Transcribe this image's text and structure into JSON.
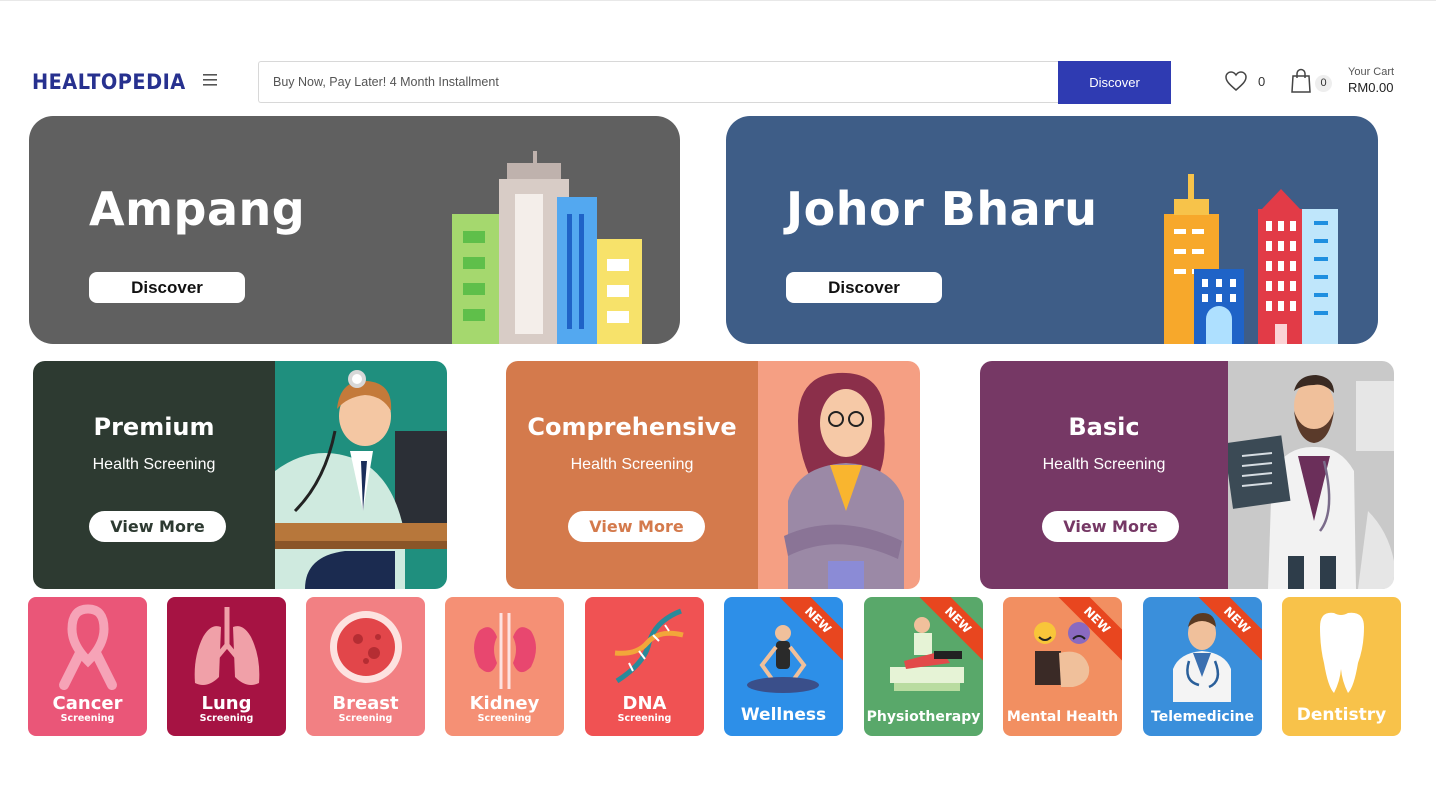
{
  "header": {
    "logo_text": "HEALTOPEDIA",
    "search_placeholder": "Buy Now, Pay Later! 4 Month Installment",
    "search_button": "Discover",
    "wishlist_count": "0",
    "cart_count": "0",
    "cart_label": "Your Cart",
    "cart_total": "RM0.00"
  },
  "cities": [
    {
      "name": "Ampang",
      "button": "Discover",
      "bg": "#606060"
    },
    {
      "name": "Johor Bharu",
      "button": "Discover",
      "bg": "#3e5d87"
    }
  ],
  "screenings": [
    {
      "title": "Premium",
      "subtitle": "Health Screening",
      "button": "View More",
      "bg": "#2d3a31",
      "art_bg": "#1f8f7e",
      "btn_color": "#2d3a31"
    },
    {
      "title": "Comprehensive",
      "subtitle": "Health Screening",
      "button": "View More",
      "bg": "#d47a4c",
      "art_bg": "#f59f83",
      "btn_color": "#d47a4c"
    },
    {
      "title": "Basic",
      "subtitle": "Health Screening",
      "button": "View More",
      "bg": "#763865",
      "art_bg": "#c9c9c9",
      "btn_color": "#763865"
    }
  ],
  "categories": [
    {
      "label": "Cancer",
      "sub": "Screening",
      "bg": "#ea5678",
      "icon": "ribbon-icon",
      "new": false
    },
    {
      "label": "Lung",
      "sub": "Screening",
      "bg": "#a61343",
      "icon": "lungs-icon",
      "new": false
    },
    {
      "label": "Breast",
      "sub": "Screening",
      "bg": "#f28083",
      "icon": "cell-icon",
      "new": false
    },
    {
      "label": "Kidney",
      "sub": "Screening",
      "bg": "#f59075",
      "icon": "kidney-icon",
      "new": false
    },
    {
      "label": "DNA",
      "sub": "Screening",
      "bg": "#f05253",
      "icon": "dna-icon",
      "new": false
    },
    {
      "label": "Wellness",
      "sub": "",
      "bg": "#2d8fe8",
      "icon": "yoga-icon",
      "new": true
    },
    {
      "label": "Physiotherapy",
      "sub": "",
      "bg": "#59a86a",
      "icon": "physio-icon",
      "new": true
    },
    {
      "label": "Mental Health",
      "sub": "",
      "bg": "#f28f61",
      "icon": "emotion-icon",
      "new": true
    },
    {
      "label": "Telemedicine",
      "sub": "",
      "bg": "#3a8fdb",
      "icon": "doctor-icon",
      "new": true
    },
    {
      "label": "Dentistry",
      "sub": "",
      "bg": "#f8c24a",
      "icon": "tooth-icon",
      "new": false
    }
  ],
  "new_badge": "NEW"
}
